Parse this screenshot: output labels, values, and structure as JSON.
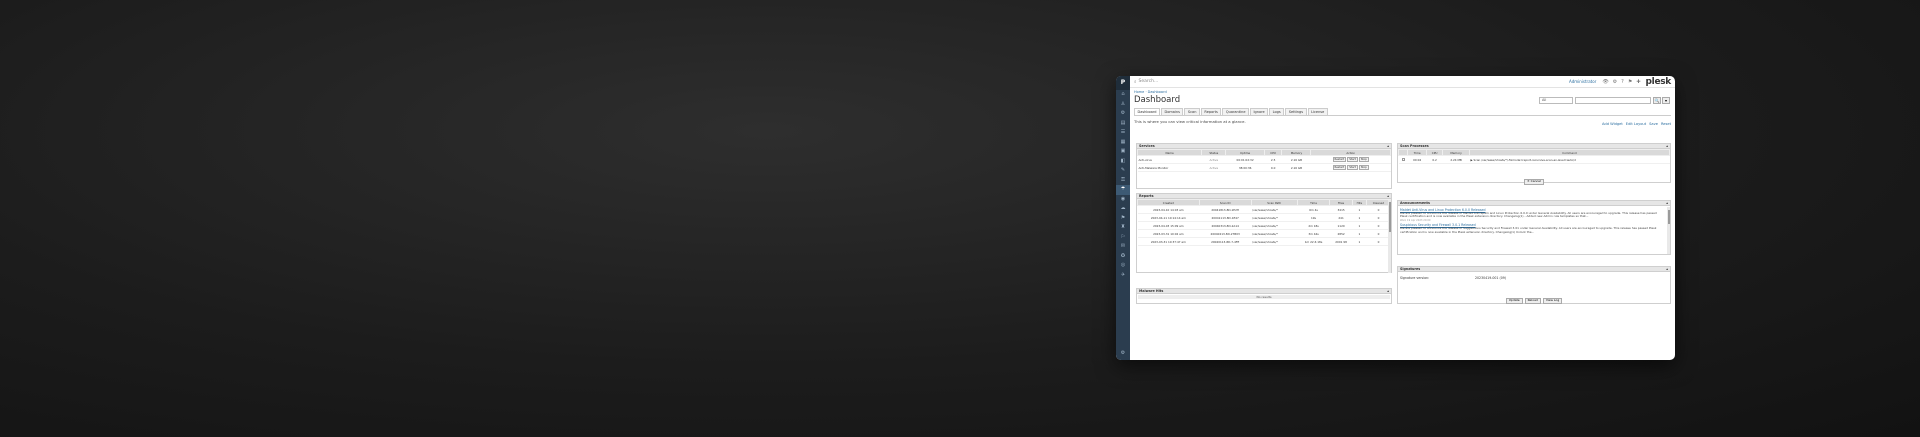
{
  "rail": {
    "logo": "P",
    "items": [
      "⌂",
      "♙",
      "⚙",
      "▤",
      "☰",
      "▦",
      "▣",
      "◧",
      "✎",
      "⚿",
      "☂",
      "◉",
      "☁",
      "⚑",
      "♜",
      "⚐",
      "✉",
      "✪",
      "◎",
      "✈"
    ],
    "active_index": 10,
    "bottom": "⚙"
  },
  "topbar": {
    "search_placeholder": "Search...",
    "user": "Administrator",
    "icons": [
      "👁",
      "⚙",
      "?",
      "⚑",
      "✚"
    ],
    "brand": "plesk"
  },
  "breadcrumbs": "Home · Dashboard",
  "title": "Dashboard",
  "controls": {
    "select_value": "All",
    "search_btn": "🔍",
    "filter_btn": "▾"
  },
  "tabs": [
    "Dashboard",
    "Domains",
    "Scan",
    "Reports",
    "Quarantine",
    "Ignore",
    "Logs",
    "Settings",
    "License"
  ],
  "description": "This is where you can view critical information at a glance.",
  "widget_actions": [
    "Add Widget",
    "Edit Layout",
    "Save",
    "Reset"
  ],
  "services": {
    "title": "Services",
    "columns": [
      "Name",
      "Status",
      "Uptime",
      "CPU",
      "Memory",
      "Action"
    ],
    "rows": [
      {
        "name": "Anti-virus",
        "status": "Active",
        "uptime": "00:01:02:32",
        "cpu": "2.5",
        "memory": "2.16 GB",
        "actions": [
          "Restart",
          "Start",
          "Stop"
        ]
      },
      {
        "name": "Anti-Malware Monitor",
        "status": "Active",
        "uptime": "38:00:36",
        "cpu": "0.0",
        "memory": "2.16 GB",
        "actions": [
          "Restart",
          "Start",
          "Stop"
        ]
      }
    ]
  },
  "reports": {
    "title": "Reports",
    "columns": [
      "Created",
      "Scan ID",
      "Scan Path",
      "Time",
      "Files",
      "Hits",
      "Cleaned"
    ],
    "rows": [
      {
        "created": "2023-04-10 14:03 am",
        "id": "20041813-8D-1E2H",
        "path": "/var/www/vhosts/*",
        "time": "6m 4s",
        "files": "3415",
        "hits": "1",
        "cleaned": "0"
      },
      {
        "created": "2023-04-11 10:14:14 am",
        "id": "20041113-8D-1E47",
        "path": "/var/www/vhosts/*",
        "time": "19s",
        "files": "241",
        "hits": "1",
        "cleaned": "0"
      },
      {
        "created": "2023-04-03 15:09 am",
        "id": "20040313-8D-2A14",
        "path": "/var/www/vhosts/*",
        "time": "2m 18s",
        "files": "1120",
        "hits": "1",
        "cleaned": "0"
      },
      {
        "created": "2023-03-31 10:02 am",
        "id": "20040213-8D-27B03",
        "path": "/var/www/vhosts/*",
        "time": "3m 44s",
        "files": "2852",
        "hits": "1",
        "cleaned": "0"
      },
      {
        "created": "2023-03-31 10:37:47 am",
        "id": "20040113-8D-7-4FE",
        "path": "/var/www/vhosts/*",
        "time": "1m 22.6 18s",
        "files": "2001 98",
        "hits": "1",
        "cleaned": "0"
      }
    ]
  },
  "malware": {
    "title": "Malware Hits",
    "empty": "No results"
  },
  "processes": {
    "title": "Scan Processes",
    "columns": [
      "",
      "Time",
      "CPU",
      "Memory",
      "Command"
    ],
    "rows": [
      {
        "time": "00:04",
        "cpu": "0.2",
        "memory": "2.24 MB",
        "command": "▶ Scan /var/www/vhosts/*/-fixmode=report-recursive-scan-ax-level=auto/d"
      }
    ],
    "cancel": "Cancel"
  },
  "announcements": {
    "title": "Announcements",
    "items": [
      {
        "title": "Maldet Anti-Virus and Linux Protection 6.0.0 Released",
        "text": "We are pleased to announce the release of Maldet Anti-Spam and Linux Protection 6.0.0 under General Availability. All users are encouraged to upgrade. This release has passed Plesk certification and is now available in the Plesk extension directory. Changelog(1) - Added new Admin rule templates so that...",
        "date": "Wed, 19 Apr 2023 20:00"
      },
      {
        "title": "Suspicious Security and Firewall 3.0.1 Released",
        "text": "We are pleased to announce the release of Suggestions Security and Firewall 3.01 under General Availability. All users are encouraged to upgrade. This release has passed Plesk certification and is now available in the Plesk extension directory. Changelog(1) Unlock the...",
        "date": ""
      }
    ]
  },
  "signatures": {
    "title": "Signatures",
    "label": "Signature version:",
    "value": "20230419-001 (09)",
    "buttons": [
      "Update",
      "Reload",
      "View Log"
    ]
  },
  "colors": {
    "rail": "#2b3d4f",
    "link": "#2b6ea0",
    "panel_head": "#e6e6e6"
  }
}
